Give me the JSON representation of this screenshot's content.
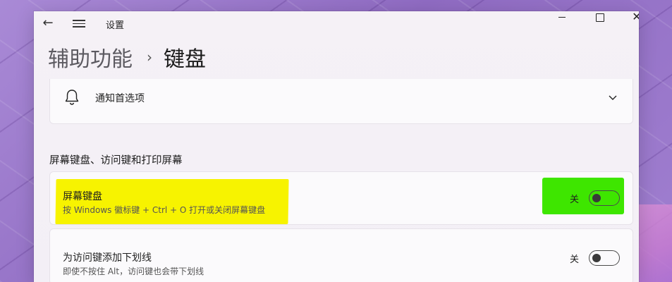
{
  "titlebar": {
    "app_title": "设置",
    "back_icon": "arrow-left-icon",
    "menu_icon": "hamburger-menu-icon",
    "window_controls": [
      "minimize",
      "maximize",
      "close"
    ]
  },
  "breadcrumb": {
    "parent": "辅助功能",
    "separator": "›",
    "current": "键盘"
  },
  "notification_card": {
    "icon": "bell-icon",
    "label": "通知首选项",
    "expand_icon": "chevron-down-icon"
  },
  "section": {
    "heading": "屏幕键盘、访问键和打印屏幕"
  },
  "settings": [
    {
      "title": "屏幕键盘",
      "description": "按 Windows 徽标键 + Ctrl + O 打开或关闭屏幕键盘",
      "state_label": "关",
      "enabled": false,
      "highlighted": true
    },
    {
      "title": "为访问键添加下划线",
      "description": "即使不按住 Alt，访问键也会带下划线",
      "state_label": "关",
      "enabled": false,
      "highlighted": false
    }
  ],
  "colors": {
    "highlight_yellow": "#f7f300",
    "highlight_green": "#3ee600",
    "desktop_purple": "#9a78c9"
  }
}
